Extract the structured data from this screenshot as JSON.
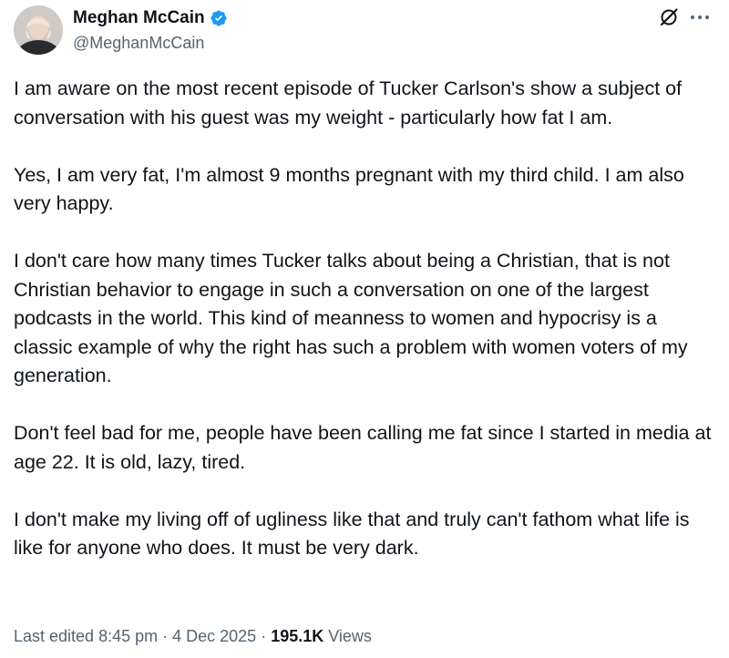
{
  "author": {
    "name": "Meghan McCain",
    "handle": "@MeghanMcCain",
    "verified": true,
    "verified_color": "#1d9bf0"
  },
  "icons": {
    "verified": "verified-badge-icon",
    "grok": "grok-icon",
    "more": "more-options-icon"
  },
  "tweet": {
    "paragraphs": [
      "I am aware on the most recent episode of Tucker Carlson's show a subject of conversation with his guest was my weight - particularly how fat I am.",
      "Yes, I am very fat, I'm almost 9 months pregnant with my third child. I am also very happy.",
      "I don't care how many times Tucker talks about being a Christian, that is not Christian behavior to engage in such a conversation on one of the largest podcasts in the world. This kind of meanness to women and hypocrisy is a classic example of why the right has such a problem with women voters of my generation.",
      "Don't feel bad for me, people have been calling me fat since I started in media at age 22. It is old, lazy, tired.",
      "I don't make my living off of ugliness like that and truly can't fathom what life is like for anyone who does. It must be very dark."
    ]
  },
  "meta": {
    "edited_label": "Last edited 8:45 pm",
    "separator": " · ",
    "date": "4 Dec 2025",
    "views_count": "195.1K",
    "views_label": " Views"
  }
}
